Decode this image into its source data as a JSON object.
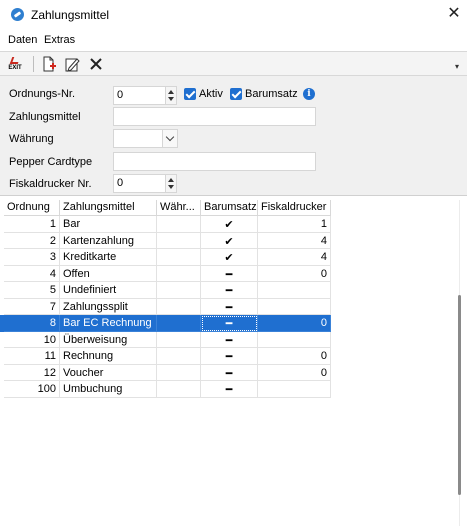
{
  "window": {
    "title": "Zahlungsmittel",
    "close_glyph": "✕"
  },
  "menu": {
    "items": [
      "Daten",
      "Extras"
    ]
  },
  "toolbar": {
    "exit_label": "EXIT",
    "more_glyph": "▾"
  },
  "form": {
    "ordnungs_nr": {
      "label": "Ordnungs-Nr.",
      "value": "0"
    },
    "aktiv": {
      "label": "Aktiv",
      "checked": true
    },
    "barumsatz": {
      "label": "Barumsatz",
      "checked": true
    },
    "info_glyph": "i",
    "zahlungsmittel": {
      "label": "Zahlungsmittel",
      "value": ""
    },
    "waehrung": {
      "label": "Währung",
      "value": ""
    },
    "pepper_cardtype": {
      "label": "Pepper Cardtype",
      "value": ""
    },
    "fiskaldrucker": {
      "label": "Fiskaldrucker Nr.",
      "value": "0"
    }
  },
  "table": {
    "columns": [
      "Ordnung",
      "Zahlungsmittel",
      "Währ...",
      "Barumsatz",
      "Fiskaldrucker"
    ],
    "rows": [
      {
        "ordnung": "1",
        "zahlungsmittel": "Bar",
        "waehrung": "",
        "barumsatz": "✔",
        "fiskaldrucker": "1"
      },
      {
        "ordnung": "2",
        "zahlungsmittel": "Kartenzahlung",
        "waehrung": "",
        "barumsatz": "✔",
        "fiskaldrucker": "4"
      },
      {
        "ordnung": "3",
        "zahlungsmittel": "Kreditkarte",
        "waehrung": "",
        "barumsatz": "✔",
        "fiskaldrucker": "4"
      },
      {
        "ordnung": "4",
        "zahlungsmittel": "Offen",
        "waehrung": "",
        "barumsatz": "━",
        "fiskaldrucker": "0"
      },
      {
        "ordnung": "5",
        "zahlungsmittel": "Undefiniert",
        "waehrung": "",
        "barumsatz": "━",
        "fiskaldrucker": ""
      },
      {
        "ordnung": "7",
        "zahlungsmittel": "Zahlungssplit",
        "waehrung": "",
        "barumsatz": "━",
        "fiskaldrucker": ""
      },
      {
        "ordnung": "8",
        "zahlungsmittel": "Bar EC Rechnung",
        "waehrung": "",
        "barumsatz": "━",
        "fiskaldrucker": "0"
      },
      {
        "ordnung": "10",
        "zahlungsmittel": "Überweisung",
        "waehrung": "",
        "barumsatz": "━",
        "fiskaldrucker": ""
      },
      {
        "ordnung": "11",
        "zahlungsmittel": "Rechnung",
        "waehrung": "",
        "barumsatz": "━",
        "fiskaldrucker": "0"
      },
      {
        "ordnung": "12",
        "zahlungsmittel": "Voucher",
        "waehrung": "",
        "barumsatz": "━",
        "fiskaldrucker": "0"
      },
      {
        "ordnung": "100",
        "zahlungsmittel": "Umbuchung",
        "waehrung": "",
        "barumsatz": "━",
        "fiskaldrucker": ""
      }
    ],
    "selected_row_index": 6
  },
  "colors": {
    "accent": "#1f6fd0",
    "form_bg": "#f0f0f0"
  }
}
